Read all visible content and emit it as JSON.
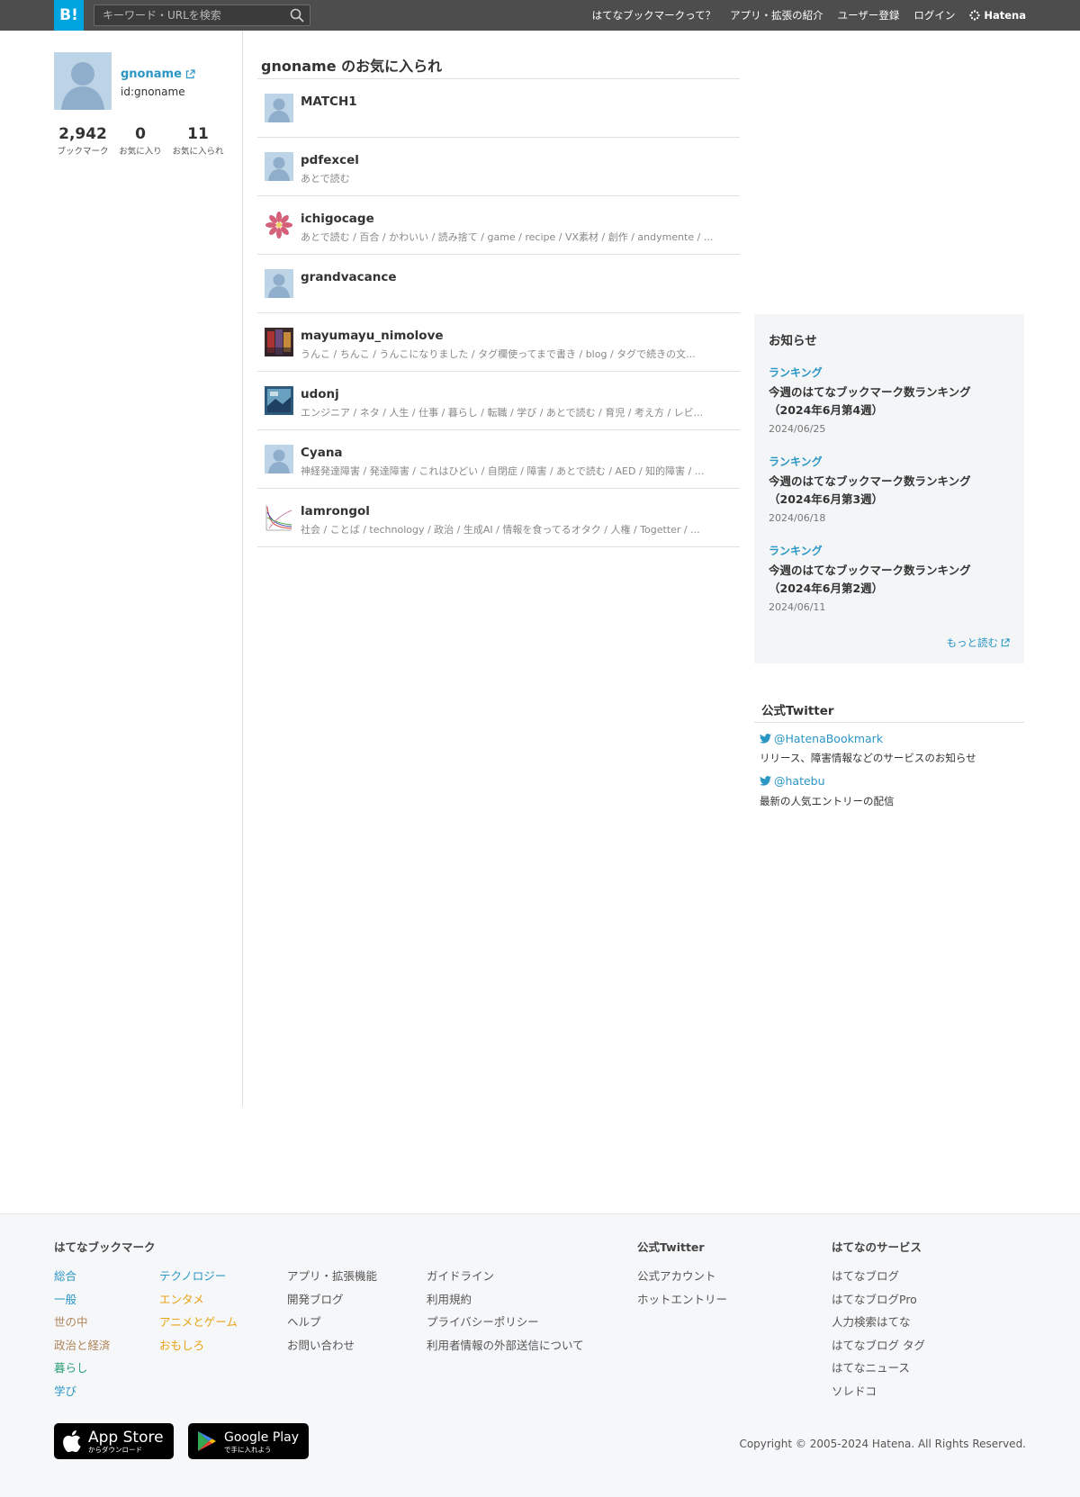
{
  "header": {
    "logo_text": "B!",
    "search_placeholder": "キーワード・URLを検索",
    "nav": [
      "はてなブックマークって？",
      "アプリ・拡張の紹介",
      "ユーザー登録",
      "ログイン"
    ],
    "brand": "Hatena"
  },
  "profile": {
    "username": "gnoname",
    "id": "id:gnoname",
    "stats": [
      {
        "value": "2,942",
        "label": "ブックマーク"
      },
      {
        "value": "0",
        "label": "お気に入り"
      },
      {
        "value": "11",
        "label": "お気に入られ"
      }
    ]
  },
  "main": {
    "title": "gnoname のお気に入られ",
    "items": [
      {
        "name": "MATCH1",
        "tags": "",
        "avatar": "default"
      },
      {
        "name": "pdfexcel",
        "tags": "あとで読む",
        "avatar": "default"
      },
      {
        "name": "ichigocage",
        "tags": "あとで読む / 百合 / かわいい / 読み捨て / game / recipe / VX素材 / 創作 / andymente / ...",
        "avatar": "flower"
      },
      {
        "name": "grandvacance",
        "tags": "",
        "avatar": "default"
      },
      {
        "name": "mayumayu_nimolove",
        "tags": "うんこ / ちんこ / うんこになりました / タグ欄使ってまで書き / blog / タグで続きの文...",
        "avatar": "photo-dark"
      },
      {
        "name": "udonj",
        "tags": "エンジニア / ネタ / 人生 / 仕事 / 暮らし / 転職 / 学び / あとで読む / 育児 / 考え方 / レビ...",
        "avatar": "photo-blue"
      },
      {
        "name": "Cyana",
        "tags": "神経発達障害 / 発達障害 / これはひどい / 自閉症 / 障害 / あとで読む / AED / 知的障害 / ...",
        "avatar": "default"
      },
      {
        "name": "lamrongol",
        "tags": "社会 / ことば / technology / 政治 / 生成AI / 情報を食ってるオタク / 人権 / Togetter / ...",
        "avatar": "graph"
      }
    ]
  },
  "news": {
    "title": "お知らせ",
    "items": [
      {
        "category": "ランキング",
        "headline": "今週のはてなブックマーク数ランキング（2024年6月第4週）",
        "date": "2024/06/25"
      },
      {
        "category": "ランキング",
        "headline": "今週のはてなブックマーク数ランキング（2024年6月第3週）",
        "date": "2024/06/18"
      },
      {
        "category": "ランキング",
        "headline": "今週のはてなブックマーク数ランキング（2024年6月第2週）",
        "date": "2024/06/11"
      }
    ],
    "more": "もっと読む"
  },
  "twitter": {
    "title": "公式Twitter",
    "accounts": [
      {
        "handle": "@HatenaBookmark",
        "desc": "リリース、障害情報などのサービスのお知らせ"
      },
      {
        "handle": "@hatebu",
        "desc": "最新の人気エントリーの配信"
      }
    ]
  },
  "footer": {
    "sections": {
      "bookmark": "はてなブックマーク",
      "twitter": "公式Twitter",
      "services": "はてなのサービス"
    },
    "categories_col1": [
      {
        "label": "総合",
        "color": "#2a96c4"
      },
      {
        "label": "一般",
        "color": "#2a96c4"
      },
      {
        "label": "世の中",
        "color": "#b0855a"
      },
      {
        "label": "政治と経済",
        "color": "#b0855a"
      },
      {
        "label": "暮らし",
        "color": "#2ea079"
      },
      {
        "label": "学び",
        "color": "#2a96c4"
      }
    ],
    "categories_col2": [
      {
        "label": "テクノロジー",
        "color": "#2a96c4"
      },
      {
        "label": "エンタメ",
        "color": "#e8a317"
      },
      {
        "label": "アニメとゲーム",
        "color": "#e8a317"
      },
      {
        "label": "おもしろ",
        "color": "#e8a317"
      }
    ],
    "links_col3": [
      "アプリ・拡張機能",
      "開発ブログ",
      "ヘルプ",
      "お問い合わせ"
    ],
    "links_col4": [
      "ガイドライン",
      "利用規約",
      "プライバシーポリシー",
      "利用者情報の外部送信について"
    ],
    "twitter_links": [
      "公式アカウント",
      "ホットエントリー"
    ],
    "service_links": [
      "はてなブログ",
      "はてなブログPro",
      "人力検索はてな",
      "はてなブログ タグ",
      "はてなニュース",
      "ソレドコ"
    ],
    "appstore": {
      "main": "App Store",
      "sub": "からダウンロード"
    },
    "googleplay": {
      "main": "Google Play",
      "sub": "で手に入れよう"
    },
    "copyright": "Copyright © 2005-2024 Hatena. All Rights Reserved."
  },
  "colors": {
    "accent": "#2a96c4",
    "topbar": "#4d4d4d",
    "logo_bg": "#00a4de"
  }
}
